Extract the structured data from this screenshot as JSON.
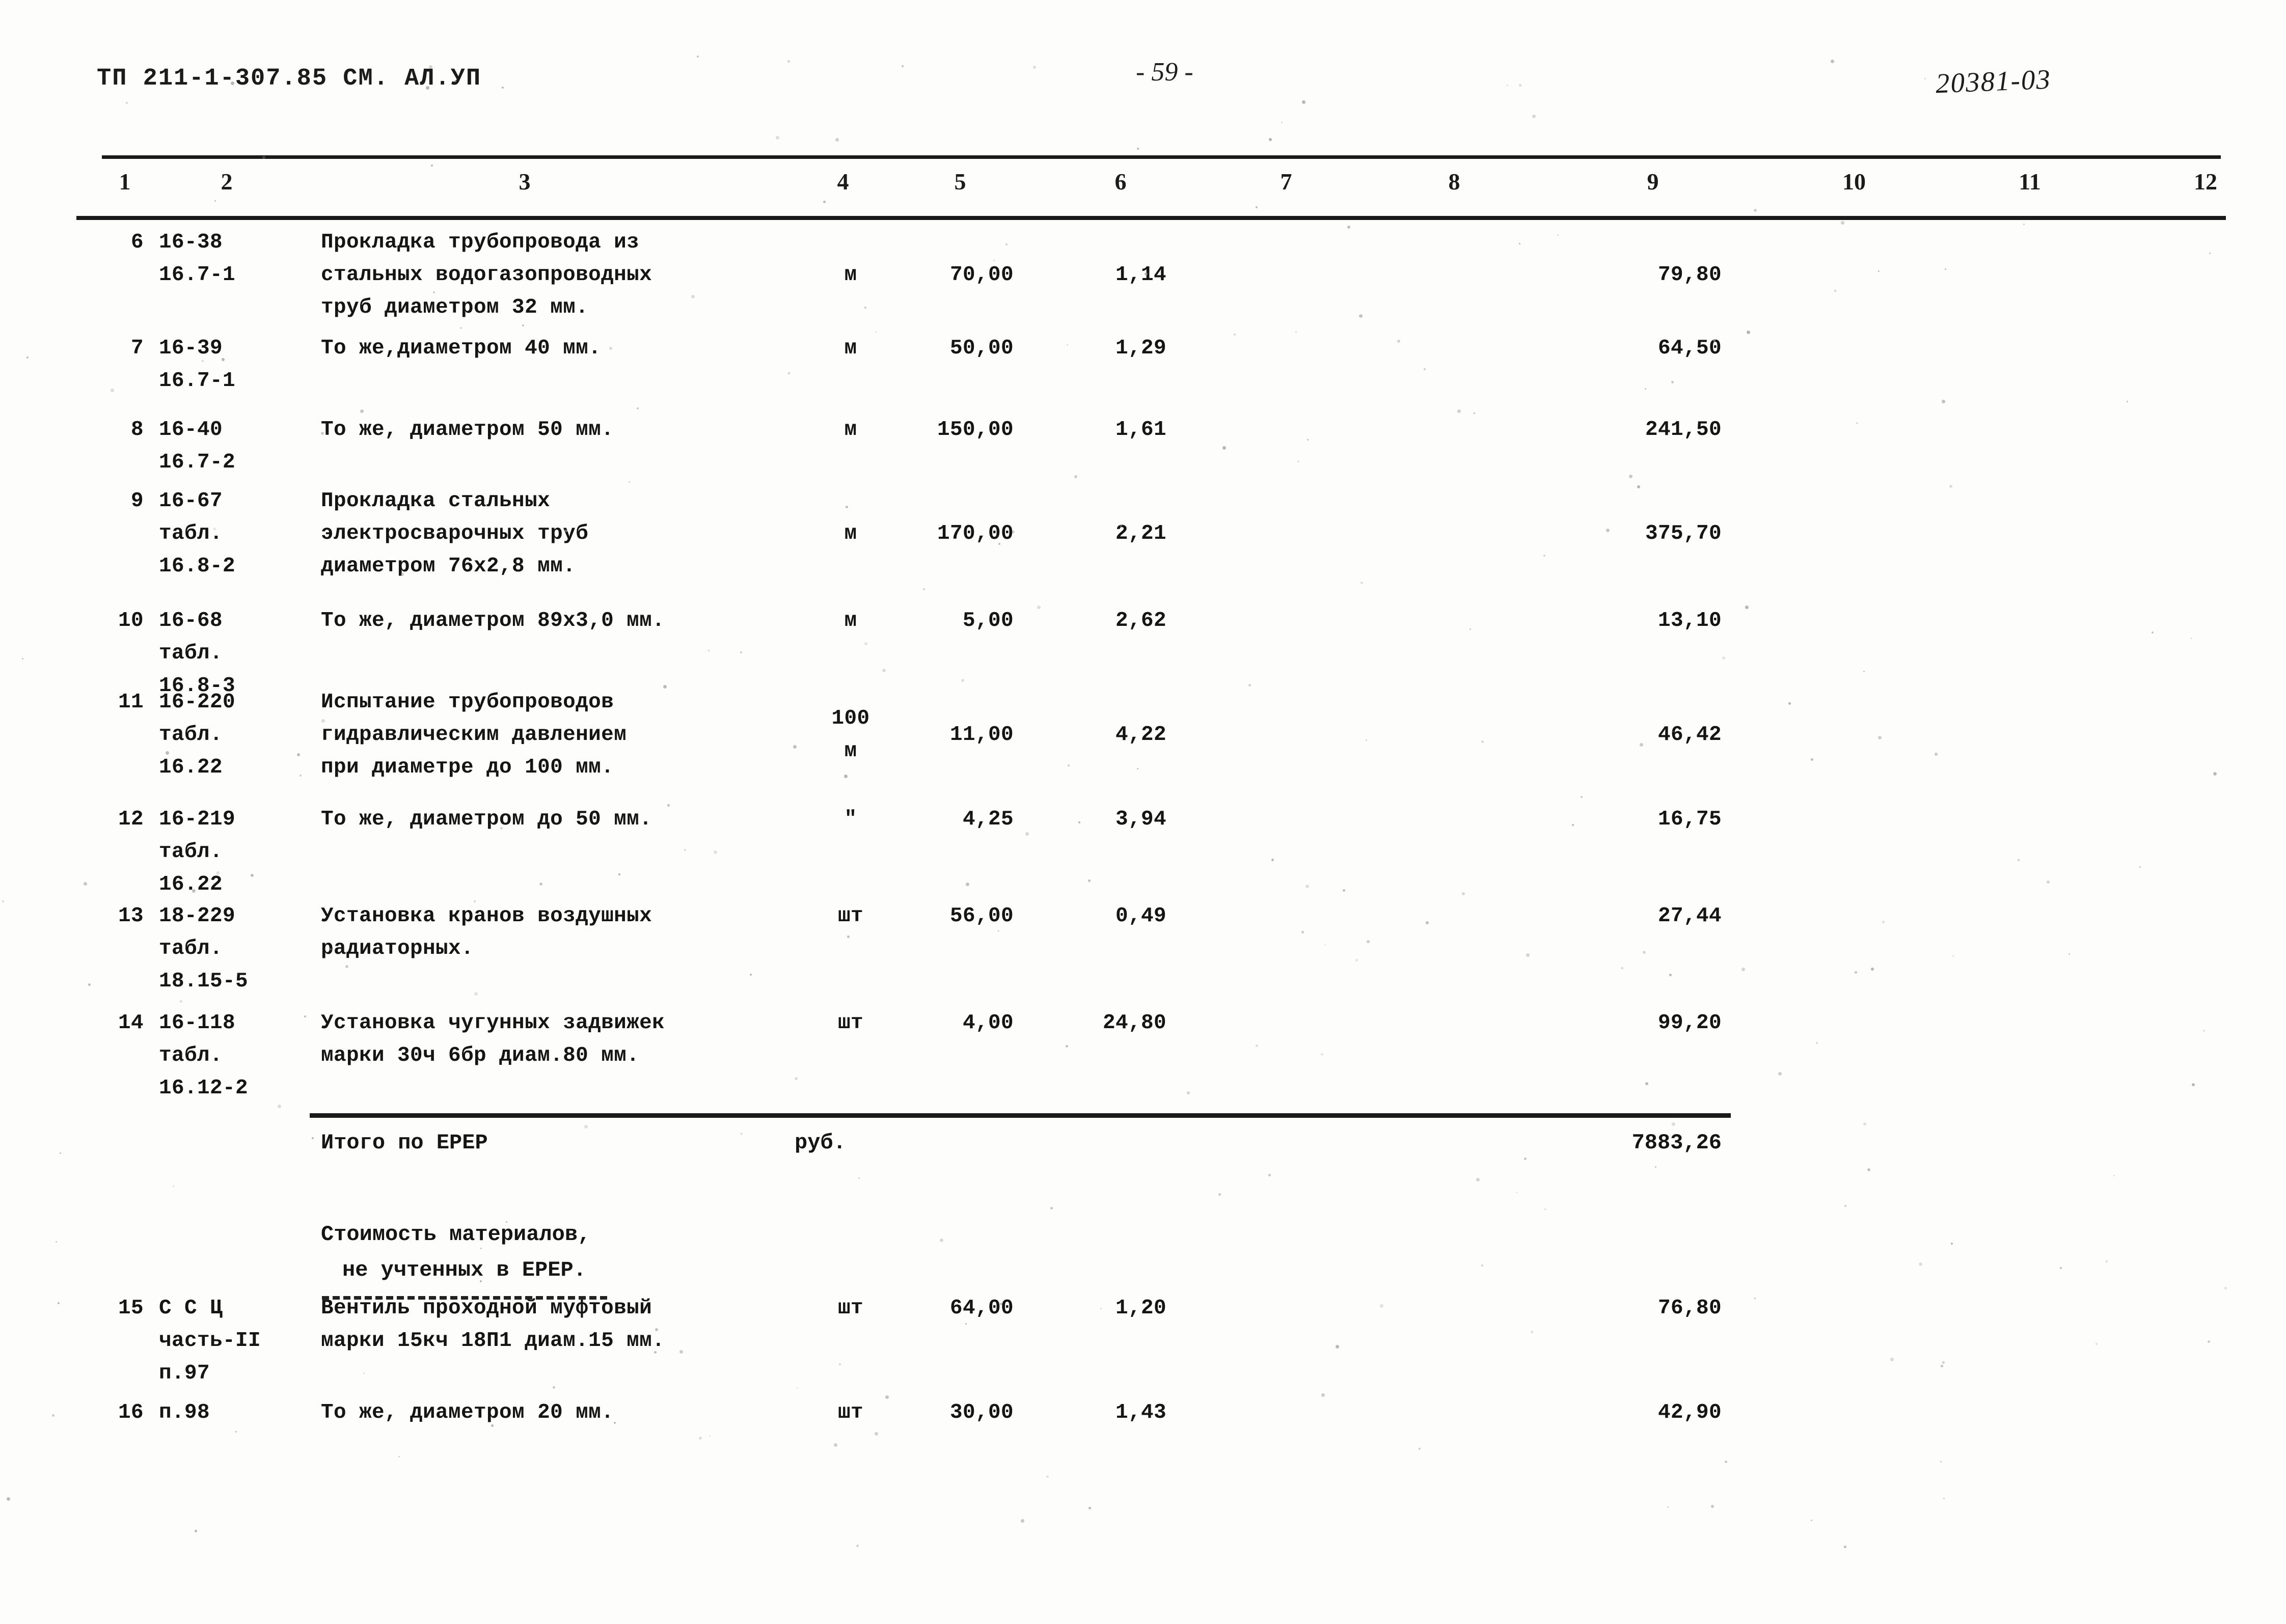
{
  "header": {
    "doc_code": "ТП 211-1-307.85  СМ. АЛ.УП",
    "page_number": "- 59 -",
    "archive_stamp": "20381-03"
  },
  "table": {
    "column_numbers": [
      "1",
      "2",
      "3",
      "4",
      "5",
      "6",
      "7",
      "8",
      "9",
      "10",
      "11",
      "12"
    ],
    "rows": [
      {
        "num": "6",
        "code": "16-38\n16.7-1",
        "desc": "Прокладка трубопровода из\nстальных водогазопроводных\nтруб диаметром 32 мм.",
        "unit": "м",
        "qty": "70,00",
        "price": "1,14",
        "total": "79,80"
      },
      {
        "num": "7",
        "code": "16-39\n16.7-1",
        "desc": "То же,диаметром 40 мм.",
        "unit": "м",
        "qty": "50,00",
        "price": "1,29",
        "total": "64,50"
      },
      {
        "num": "8",
        "code": "16-40\n16.7-2",
        "desc": "То же, диаметром 50 мм.",
        "unit": "м",
        "qty": "150,00",
        "price": "1,61",
        "total": "241,50"
      },
      {
        "num": "9",
        "code": "16-67\nтабл.\n16.8-2",
        "desc": "Прокладка стальных\nэлектросварочных труб\nдиаметром 76х2,8 мм.",
        "unit": "м",
        "qty": "170,00",
        "price": "2,21",
        "total": "375,70"
      },
      {
        "num": "10",
        "code": "16-68\nтабл.\n16.8-3",
        "desc": "То же, диаметром 89х3,0 мм.",
        "unit": "м",
        "qty": "5,00",
        "price": "2,62",
        "total": "13,10"
      },
      {
        "num": "11",
        "code": "16-220\nтабл.\n16.22",
        "desc": "Испытание трубопроводов\nгидравлическим давлением\nпри диаметре до 100 мм.",
        "unit": "100\nм",
        "qty": "11,00",
        "price": "4,22",
        "total": "46,42"
      },
      {
        "num": "12",
        "code": "16-219\nтабл.\n16.22",
        "desc": "То же, диаметром до 50 мм.",
        "unit": "\"",
        "qty": "4,25",
        "price": "3,94",
        "total": "16,75"
      },
      {
        "num": "13",
        "code": "18-229\nтабл.\n18.15-5",
        "desc": "Установка кранов воздушных\nрадиаторных.",
        "unit": "шт",
        "qty": "56,00",
        "price": "0,49",
        "total": "27,44"
      },
      {
        "num": "14",
        "code": "16-118\nтабл.\n16.12-2",
        "desc": "Установка чугунных задвижек\nмарки 30ч 6бр диам.80 мм.",
        "unit": "шт",
        "qty": "4,00",
        "price": "24,80",
        "total": "99,20"
      },
      {
        "num": "15",
        "code": "С С Ц\nчасть-II\nп.97",
        "desc": "Вентиль проходной муфтовый\nмарки 15кч 18П1 диам.15 мм.",
        "unit": "шт",
        "qty": "64,00",
        "price": "1,20",
        "total": "76,80"
      },
      {
        "num": "16",
        "code": "п.98",
        "desc": "То же, диаметром 20 мм.",
        "unit": "шт",
        "qty": "30,00",
        "price": "1,43",
        "total": "42,90"
      }
    ]
  },
  "totals": {
    "erer_label": "Итого по ЕРЕР",
    "erer_unit": "руб.",
    "erer_value": "7883,26",
    "materials_line1": "Стоимость материалов,",
    "materials_line2": "не учтенных в ЕРЕР."
  }
}
